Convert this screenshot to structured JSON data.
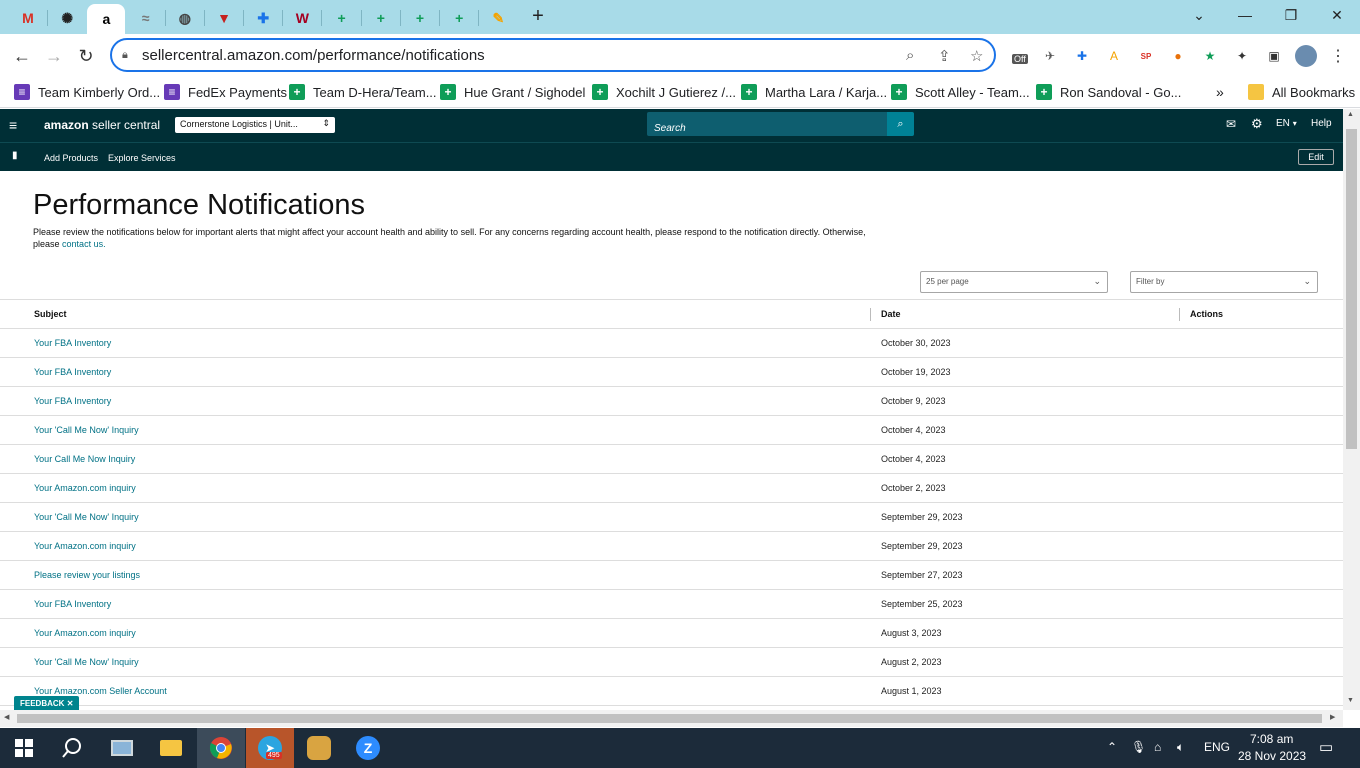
{
  "browser": {
    "url": "sellercentral.amazon.com/performance/notifications",
    "tabs": [
      {
        "icon": "gmail-icon",
        "glyph": "M",
        "color": "#d93025"
      },
      {
        "icon": "openai-icon",
        "glyph": "✺",
        "color": "#222"
      },
      {
        "icon": "amazon-icon",
        "glyph": "a",
        "color": "#000"
      },
      {
        "icon": "tab-icon",
        "glyph": "≈",
        "color": "#777"
      },
      {
        "icon": "globe-icon",
        "glyph": "◍",
        "color": "#444"
      },
      {
        "icon": "triangle-icon",
        "glyph": "▼",
        "color": "#c5221f"
      },
      {
        "icon": "ext-icon",
        "glyph": "✚",
        "color": "#1a73e8"
      },
      {
        "icon": "wendys-icon",
        "glyph": "W",
        "color": "#a50021"
      },
      {
        "icon": "sheets-icon",
        "glyph": "+",
        "color": "#0f9d58"
      },
      {
        "icon": "sheets-icon",
        "glyph": "+",
        "color": "#0f9d58"
      },
      {
        "icon": "sheets-icon",
        "glyph": "+",
        "color": "#0f9d58"
      },
      {
        "icon": "sheets-icon",
        "glyph": "+",
        "color": "#0f9d58"
      },
      {
        "icon": "pen-icon",
        "glyph": "✎",
        "color": "#f4a300"
      }
    ],
    "bookmarks": [
      {
        "label": "Team Kimberly Ord...",
        "icon": "forms-icon",
        "color": "#673ab7"
      },
      {
        "label": "FedEx Payments",
        "icon": "forms-icon",
        "color": "#673ab7"
      },
      {
        "label": "Team D-Hera/Team...",
        "icon": "sheets-icon",
        "color": "#0f9d58"
      },
      {
        "label": "Hue Grant / Sighodel",
        "icon": "sheets-icon",
        "color": "#0f9d58"
      },
      {
        "label": "Xochilt J Gutierez /...",
        "icon": "sheets-icon",
        "color": "#0f9d58"
      },
      {
        "label": "Martha Lara / Karja...",
        "icon": "sheets-icon",
        "color": "#0f9d58"
      },
      {
        "label": "Scott Alley - Team...",
        "icon": "sheets-icon",
        "color": "#0f9d58"
      },
      {
        "label": "Ron Sandoval - Go...",
        "icon": "sheets-icon",
        "color": "#0f9d58"
      }
    ],
    "all_bookmarks": "All Bookmarks",
    "ext_badge": "Off"
  },
  "seller": {
    "logo_amazon": "amazon",
    "logo_suffix": "seller central",
    "account": "Cornerstone Logistics | Unit...",
    "search_placeholder": "Search",
    "lang": "EN",
    "help": "Help",
    "nav": [
      "Add Products",
      "Explore Services"
    ],
    "edit": "Edit"
  },
  "page": {
    "title": "Performance Notifications",
    "desc": "Please review the notifications below for important alerts that might affect your account health and ability to sell. For any concerns regarding account health, please respond to the notification directly. Otherwise, please",
    "desc_link": "contact us.",
    "per_page": "25 per page",
    "filter_placeholder": "Filter by",
    "columns": {
      "subject": "Subject",
      "date": "Date",
      "actions": "Actions"
    },
    "rows": [
      {
        "subject": "Your FBA Inventory",
        "date": "October 30, 2023"
      },
      {
        "subject": "Your FBA Inventory",
        "date": "October 19, 2023"
      },
      {
        "subject": "Your FBA Inventory",
        "date": "October 9, 2023"
      },
      {
        "subject": "Your 'Call Me Now' Inquiry",
        "date": "October 4, 2023"
      },
      {
        "subject": "Your Call Me Now Inquiry",
        "date": "October 4, 2023"
      },
      {
        "subject": "Your Amazon.com inquiry",
        "date": "October 2, 2023"
      },
      {
        "subject": "Your 'Call Me Now' Inquiry",
        "date": "September 29, 2023"
      },
      {
        "subject": "Your Amazon.com inquiry",
        "date": "September 29, 2023"
      },
      {
        "subject": "Please review your listings",
        "date": "September 27, 2023"
      },
      {
        "subject": "Your FBA Inventory",
        "date": "September 25, 2023"
      },
      {
        "subject": "Your Amazon.com inquiry",
        "date": "August 3, 2023"
      },
      {
        "subject": "Your 'Call Me Now' Inquiry",
        "date": "August 2, 2023"
      },
      {
        "subject": "Your Amazon.com Seller Account",
        "date": "August 1, 2023"
      }
    ],
    "feedback": "FEEDBACK"
  },
  "taskbar": {
    "lang": "ENG",
    "time": "7:08 am",
    "date": "28 Nov 2023",
    "telegram_badge": "495"
  }
}
